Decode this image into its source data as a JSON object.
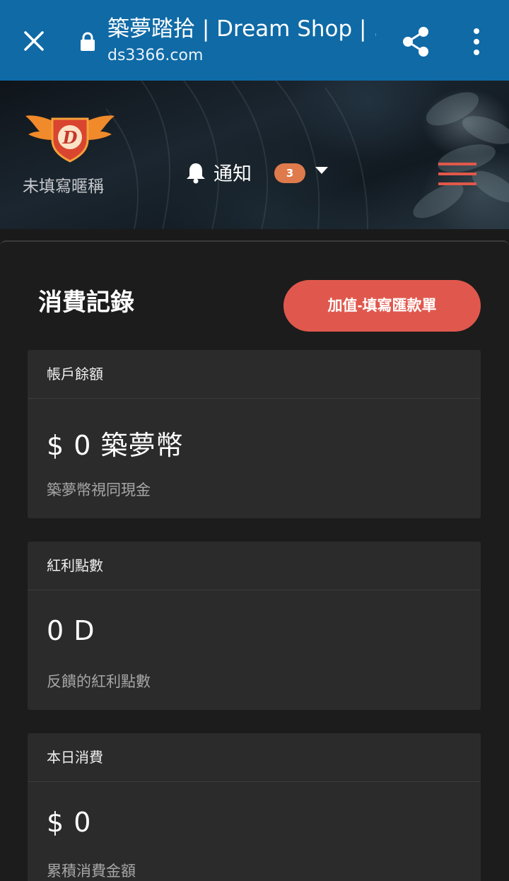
{
  "browser": {
    "title": "築夢踏拾 | Dream Shop | ...",
    "url": "ds3366.com",
    "icons": [
      "close-icon",
      "lock-icon",
      "share-icon",
      "more-vert-icon"
    ]
  },
  "header": {
    "nickname": "未填寫暱稱",
    "notify_label": "通知",
    "notify_count": "3",
    "icons": [
      "logo-icon",
      "bell-icon",
      "caret-down-icon",
      "hamburger-icon"
    ],
    "colors": {
      "badge": "#df7a4c",
      "hamburger": "#e0584a"
    }
  },
  "main": {
    "title": "消費記錄",
    "topup_button": "加值-填寫匯款單",
    "accent_color": "#e0584d",
    "cards": [
      {
        "heading": "帳戶餘額",
        "value": "$ 0 築夢幣",
        "note": "築夢幣視同現金"
      },
      {
        "heading": "紅利點數",
        "value": "0 D",
        "note": "反饋的紅利點數"
      },
      {
        "heading": "本日消費",
        "value": "$ 0",
        "note": "累積消費金額"
      }
    ]
  }
}
